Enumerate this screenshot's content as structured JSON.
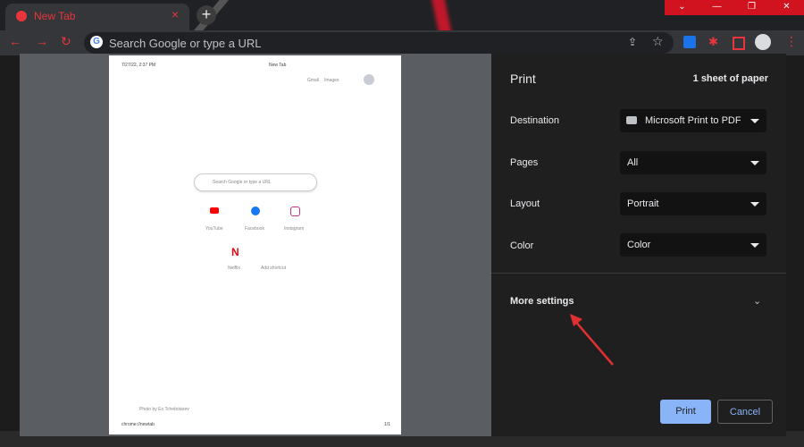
{
  "browser": {
    "tab_title": "New Tab",
    "tab_close": "×",
    "new_tab": "+",
    "omnibox_placeholder": "Search Google or type a URL",
    "window_controls": [
      "⌄",
      "—",
      "❐",
      "✕"
    ]
  },
  "preview": {
    "header_datetime": "7/27/22, 2:37 PM",
    "header_title": "New Tab",
    "links": [
      "Gmail",
      "Images"
    ],
    "search_placeholder": "Search Google or type a URL",
    "shortcuts": [
      {
        "label": "YouTube",
        "color": "#ff0000"
      },
      {
        "label": "Facebook",
        "color": "#1877f2"
      },
      {
        "label": "Instagram",
        "color": "#c13584"
      },
      {
        "label": "Netflix",
        "color": "#e50914"
      },
      {
        "label": "Add shortcut",
        "color": "#888888"
      }
    ],
    "photo_credit": "Photo by Eo Tchebotarev",
    "footer_url": "chrome://newtab",
    "footer_page": "1/1"
  },
  "print_panel": {
    "title": "Print",
    "sheet_count": "1 sheet of paper",
    "destination": {
      "label": "Destination",
      "value": "Microsoft Print to PDF"
    },
    "pages": {
      "label": "Pages",
      "value": "All"
    },
    "layout": {
      "label": "Layout",
      "value": "Portrait"
    },
    "color": {
      "label": "Color",
      "value": "Color"
    },
    "more_settings": "More settings",
    "print_button": "Print",
    "cancel_button": "Cancel",
    "accent": "#8ab4f8"
  },
  "annotation": {
    "arrow_color": "#e03030"
  }
}
